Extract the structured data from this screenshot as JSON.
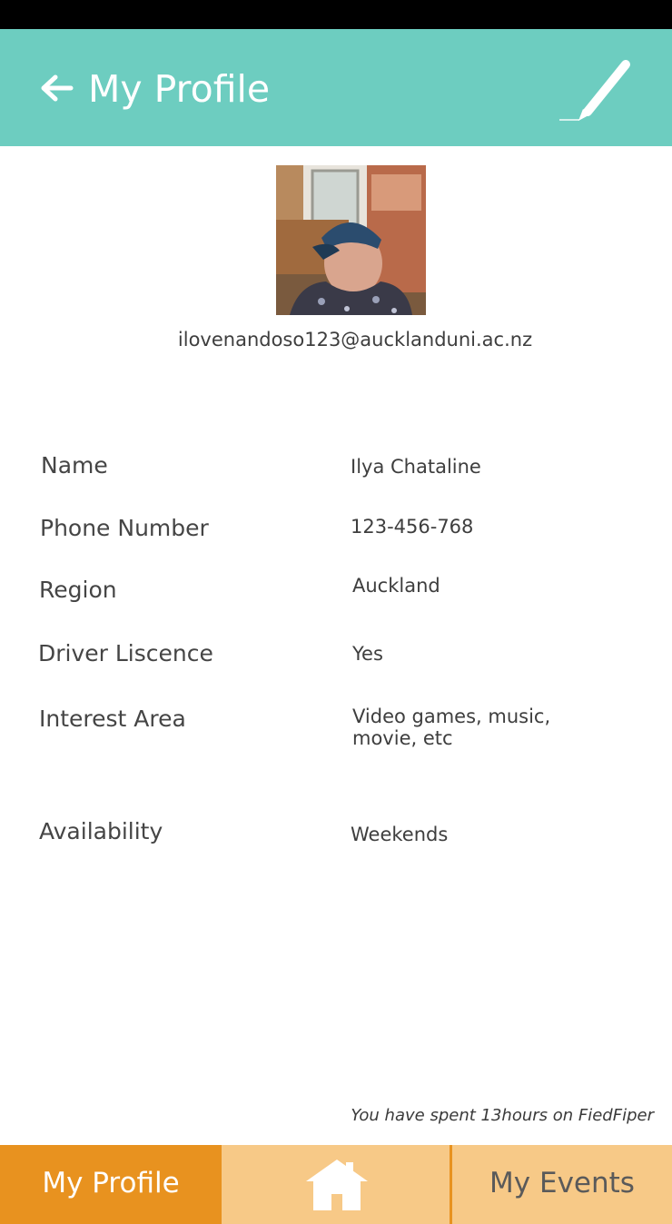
{
  "header": {
    "title": "My Profile",
    "back_icon": "arrow-left-icon",
    "edit_icon": "pencil-icon",
    "background": "#6dcdc0"
  },
  "profile": {
    "email": "ilovenandoso123@aucklanduni.ac.nz",
    "fields": [
      {
        "label": "Name",
        "value": "Ilya Chataline"
      },
      {
        "label": "Phone Number",
        "value": "123-456-768"
      },
      {
        "label": "Region",
        "value": "Auckland"
      },
      {
        "label": "Driver Liscence",
        "value": "Yes"
      },
      {
        "label": "Interest Area",
        "value_line1": "Video games, music,",
        "value_line2": "movie, etc"
      },
      {
        "label": "Availability",
        "value": "Weekends"
      }
    ]
  },
  "footer_note": "You have spent 13hours on FiedFiper",
  "bottom_nav": {
    "items": [
      {
        "label": "My Profile",
        "active": true
      },
      {
        "icon": "home-icon"
      },
      {
        "label": "My Events"
      }
    ],
    "active_color": "#e8921f",
    "inactive_color": "#f7c987"
  }
}
